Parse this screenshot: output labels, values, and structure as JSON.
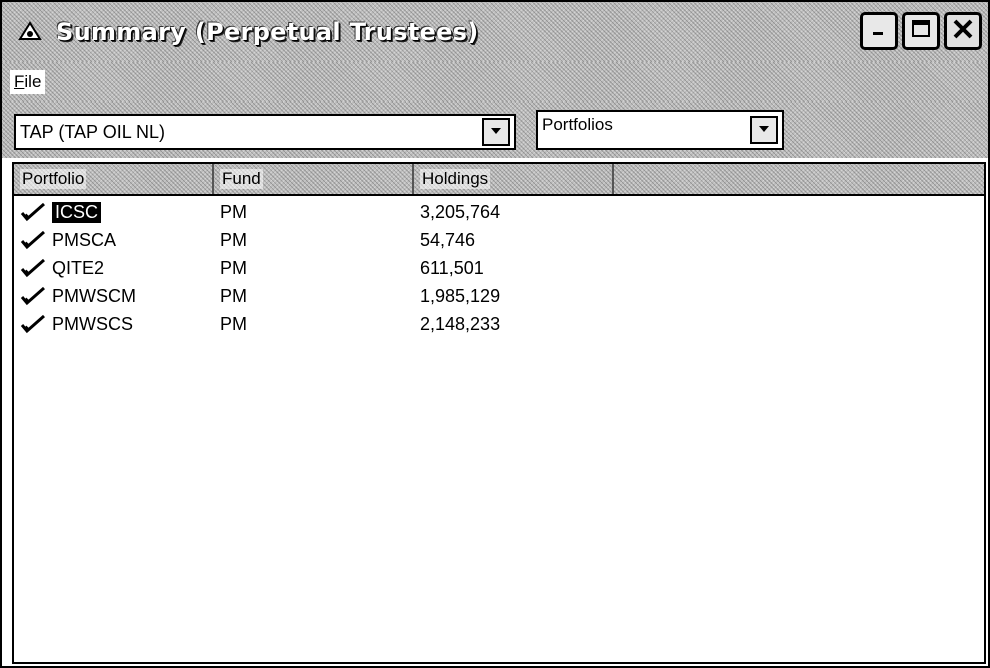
{
  "window": {
    "title": "Summary (Perpetual Trustees)"
  },
  "menu": {
    "file_label_underlined": "F",
    "file_label_rest": "ile"
  },
  "toolbar": {
    "security_value": "TAP (TAP OIL NL)",
    "view_value": "Portfolios"
  },
  "table": {
    "columns": [
      "Portfolio",
      "Fund",
      "Holdings"
    ],
    "rows": [
      {
        "portfolio": "ICSC",
        "fund": "PM",
        "holdings": "3,205,764",
        "selected": true
      },
      {
        "portfolio": "PMSCA",
        "fund": "PM",
        "holdings": "54,746",
        "selected": false
      },
      {
        "portfolio": "QITE2",
        "fund": "PM",
        "holdings": "611,501",
        "selected": false
      },
      {
        "portfolio": "PMWSCM",
        "fund": "PM",
        "holdings": "1,985,129",
        "selected": false
      },
      {
        "portfolio": "PMWSCS",
        "fund": "PM",
        "holdings": "2,148,233",
        "selected": false
      }
    ]
  },
  "icons": {
    "title": "app-window-icon",
    "row": "checkmark-icon",
    "minimize": "minimize-icon",
    "maximize": "maximize-icon",
    "close": "close-icon"
  }
}
